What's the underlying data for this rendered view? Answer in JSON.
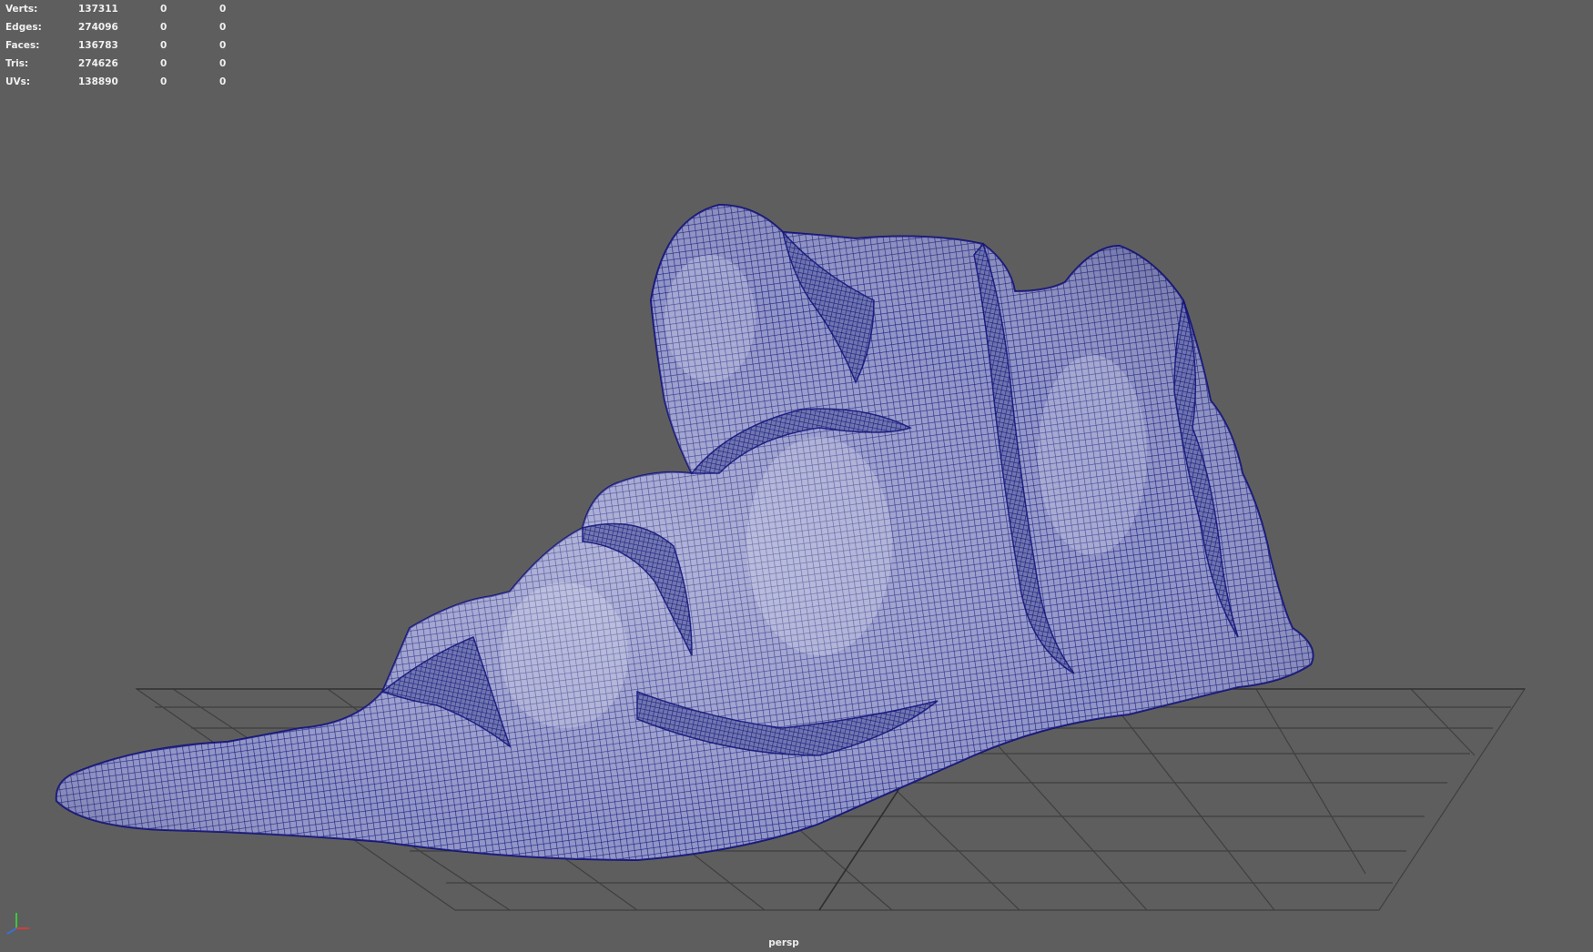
{
  "hud": {
    "rows": [
      {
        "label": "Verts:",
        "v1": "137311",
        "v2": "0",
        "v3": "0"
      },
      {
        "label": "Edges:",
        "v1": "274096",
        "v2": "0",
        "v3": "0"
      },
      {
        "label": "Faces:",
        "v1": "136783",
        "v2": "0",
        "v3": "0"
      },
      {
        "label": "Tris:",
        "v1": "274626",
        "v2": "0",
        "v3": "0"
      },
      {
        "label": "UVs:",
        "v1": "138890",
        "v2": "0",
        "v3": "0"
      }
    ]
  },
  "viewport": {
    "camera": "persp",
    "background": "#5e5e5e",
    "grid_color": "#3a3a3a",
    "wire_color": "#14147a",
    "mesh_fill": "#7a80b4"
  },
  "axis_gizmo": {
    "x_color": "#d23c3c",
    "y_color": "#3cc83c",
    "z_color": "#3c6ed2",
    "icon": "axis-triad-icon"
  }
}
